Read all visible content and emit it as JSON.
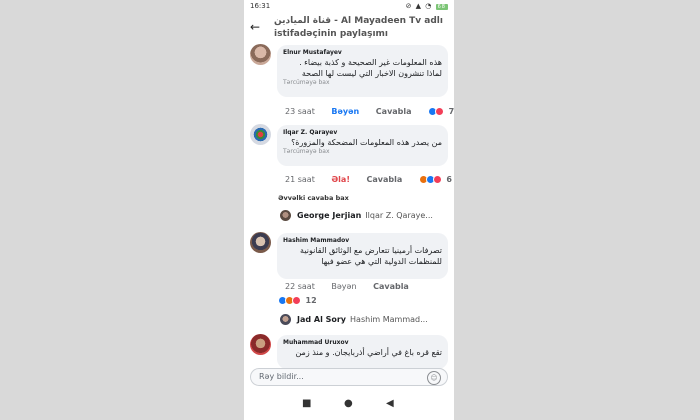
{
  "status": {
    "time": "16:31",
    "icons": "⊘ ▲ ◔",
    "battery": "68"
  },
  "header": {
    "back": "←",
    "title": "قناة الميادين - Al Mayadeen Tv adlı istifadəçinin paylaşımı"
  },
  "comments": [
    {
      "author": "Elnur Mustafayev",
      "text": [
        "هذه المعلومات غير الصحيحة و كذبة بيضاء .",
        "لماذا تنشرون الاخبار التي ليست لها الصحة"
      ],
      "translate": "Tərcüməyə bax",
      "time": "23 saat",
      "reaction_label": "Bəyən",
      "reply": "Cavabla",
      "reaction_count": "7"
    },
    {
      "author": "Ilqar Z. Qarayev",
      "text": [
        "من يصدر هذه المعلومات المضحكة والمزورة؟"
      ],
      "translate": "Tərcüməyə bax",
      "time": "21 saat",
      "reaction_label": "Əla!",
      "reply": "Cavabla",
      "reaction_count": "6"
    },
    {
      "author": "Hashim Mammadov",
      "text": [
        "تصرفات أرمينيا تتعارض مع الوثائق القانونية",
        "للمنظمات الدولية التي هي عضو فيها"
      ],
      "time": "22 saat",
      "reaction_label": "Bəyən",
      "reply": "Cavabla",
      "reaction_count": "12"
    },
    {
      "author": "Muhammad Uruxov",
      "text": [
        "تقع  قره باغ في أراضي أذربايجان. و منذ زمن"
      ]
    }
  ],
  "previous_replies": "Əvvəlki cavaba bax",
  "reply_previews": [
    {
      "author": "George Jerjian",
      "mention": "Ilqar Z. Qaraye..."
    },
    {
      "author": "Jad Al Sory",
      "mention": "Hashim Mammad..."
    }
  ],
  "composer": {
    "placeholder": "Rəy bildir...",
    "emoji": "☺"
  },
  "navbar": {
    "stop": "■",
    "home": "●",
    "back": "◀"
  }
}
